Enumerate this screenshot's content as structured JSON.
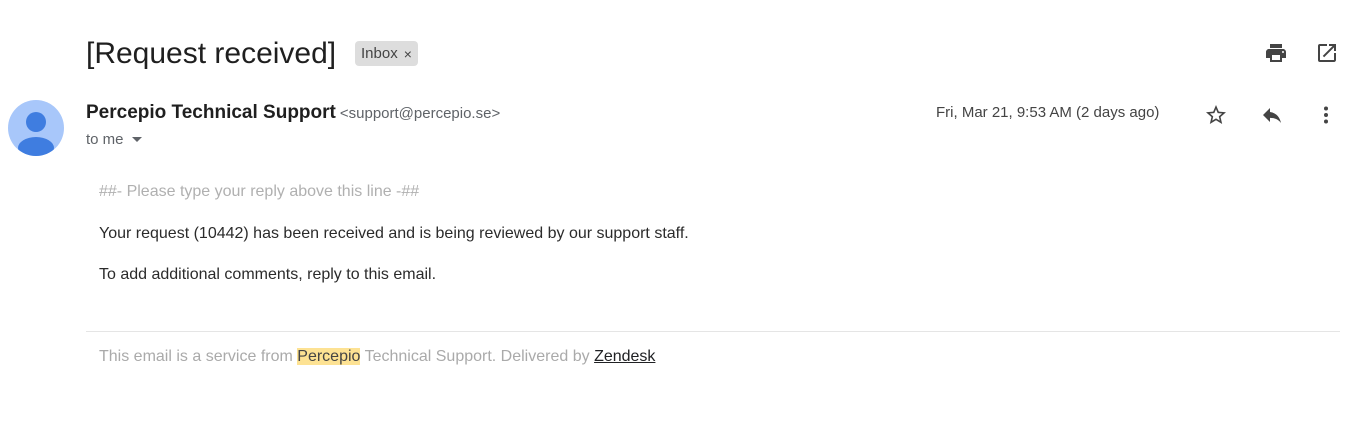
{
  "subject": "[Request received]",
  "label": {
    "name": "Inbox",
    "remove": "×"
  },
  "header_actions": {
    "print": "print-icon",
    "open_new": "open-in-new-window-icon"
  },
  "message": {
    "sender_name": "Percepio Technical Support",
    "sender_email": "<support@percepio.se>",
    "recipient": "to me",
    "date": "Fri, Mar 21, 9:53 AM (2 days ago)",
    "actions": {
      "star": "star-icon",
      "reply": "reply-icon",
      "more": "more-vert-icon"
    },
    "reply_marker": "##- Please type your reply above this line -##",
    "body_line_1": "Your request (10442) has been received and is being reviewed by our support staff.",
    "body_line_2": "To add additional comments, reply to this email."
  },
  "footer": {
    "prefix": "This email is a service from",
    "highlight": "Percepio",
    "middle": "Technical Support. Delivered by",
    "link": "Zendesk"
  },
  "colors": {
    "avatar_bg": "#a8c7fa",
    "avatar_fg": "#4a7fd9",
    "highlight": "#fde293",
    "chip_bg": "#dddddd"
  }
}
